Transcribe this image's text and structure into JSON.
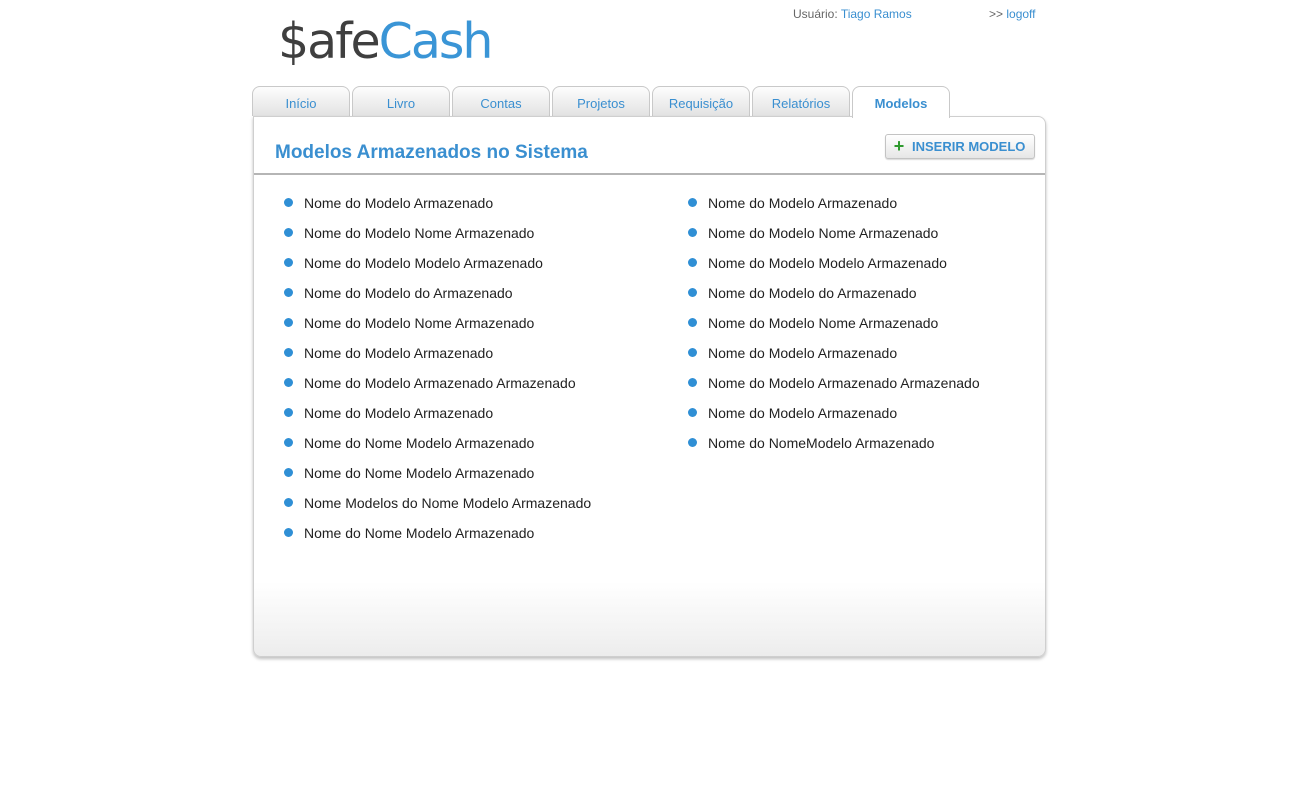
{
  "header": {
    "logo_part1": "$afe",
    "logo_part2": "Cash",
    "user_label": "Usuário:",
    "user_name": "Tiago Ramos",
    "logoff_prefix": ">>",
    "logoff_label": "logoff"
  },
  "tabs": [
    {
      "label": "Início"
    },
    {
      "label": "Livro"
    },
    {
      "label": "Contas"
    },
    {
      "label": "Projetos"
    },
    {
      "label": "Requisição"
    },
    {
      "label": "Relatórios"
    },
    {
      "label": "Modelos",
      "active": true
    }
  ],
  "panel": {
    "title": "Modelos Armazenados no Sistema",
    "insert_button": "INSERIR MODELO"
  },
  "models_left": [
    "Nome do Modelo Armazenado",
    "Nome do Modelo Nome Armazenado",
    "Nome do Modelo Modelo Armazenado",
    "Nome do Modelo do Armazenado",
    "Nome do Modelo Nome Armazenado",
    "Nome do Modelo Armazenado",
    "Nome do Modelo Armazenado Armazenado",
    "Nome do Modelo Armazenado",
    "Nome do Nome Modelo Armazenado",
    "Nome do Nome Modelo Armazenado",
    "Nome Modelos do Nome Modelo Armazenado",
    "Nome do Nome Modelo Armazenado"
  ],
  "models_right": [
    "Nome do Modelo Armazenado",
    "Nome do Modelo Nome Armazenado",
    "Nome do Modelo Modelo Armazenado",
    "Nome do Modelo do Armazenado",
    "Nome do Modelo Nome Armazenado",
    "Nome do Modelo Armazenado",
    "Nome do Modelo Armazenado Armazenado",
    "Nome do Modelo Armazenado",
    "Nome do NomeModelo Armazenado"
  ],
  "colors": {
    "accent": "#3a8fd0",
    "bullet": "#2f8fd5",
    "plus": "#2e9a2e",
    "logo_dark": "#3f3f3f"
  }
}
